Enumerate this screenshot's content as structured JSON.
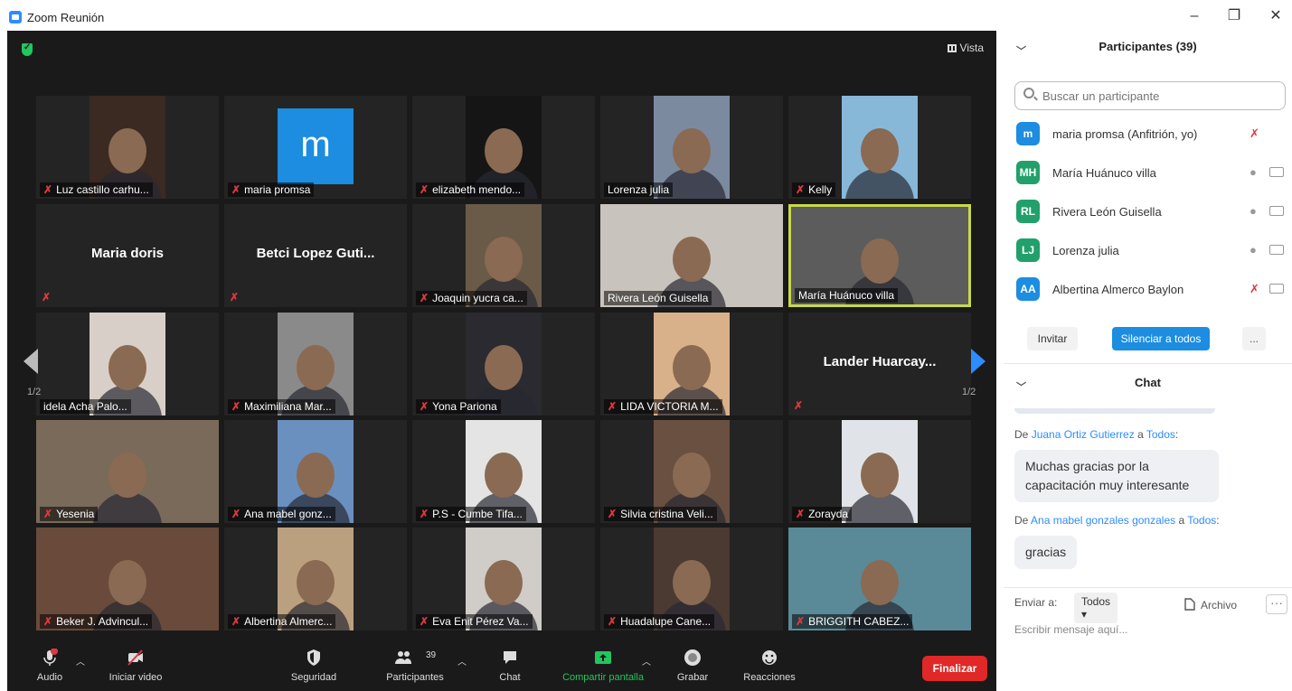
{
  "window": {
    "title": "Zoom Reunión"
  },
  "meeting": {
    "view_label": "Vista",
    "page_indicator": "1/2",
    "tiles": [
      {
        "name": "Luz castillo carhu...",
        "muted": true,
        "type": "video",
        "tone": "#3a2a22"
      },
      {
        "name": "maria promsa",
        "muted": true,
        "type": "avatar",
        "letter": "m"
      },
      {
        "name": "elizabeth mendo...",
        "muted": true,
        "type": "video",
        "tone": "#151515"
      },
      {
        "name": "Lorenza julia",
        "muted": false,
        "type": "video",
        "tone": "#7c8aa0"
      },
      {
        "name": "Kelly",
        "muted": true,
        "type": "video",
        "tone": "#88b8d8"
      },
      {
        "name": "Maria doris",
        "muted": true,
        "type": "name"
      },
      {
        "name": "Betci Lopez Guti...",
        "muted": true,
        "type": "name"
      },
      {
        "name": "Joaquin yucra ca...",
        "muted": true,
        "type": "video",
        "tone": "#6a5a48"
      },
      {
        "name": "Rivera León Guisella",
        "muted": false,
        "type": "video",
        "tone": "#c9c3bd"
      },
      {
        "name": "María Huánuco villa",
        "muted": false,
        "type": "video",
        "tone": "#5c5c5c",
        "active": true
      },
      {
        "name": "idela Acha Palo...",
        "muted": false,
        "type": "video",
        "tone": "#d8d0c8"
      },
      {
        "name": "Maximiliana Mar...",
        "muted": true,
        "type": "video",
        "tone": "#8a8a8a"
      },
      {
        "name": "Yona Pariona",
        "muted": true,
        "type": "video",
        "tone": "#2a2a30"
      },
      {
        "name": "LIDA VICTORIA M...",
        "muted": true,
        "type": "video",
        "tone": "#d8b08a"
      },
      {
        "name": "Lander Huarcay...",
        "muted": true,
        "type": "name"
      },
      {
        "name": "Yesenia",
        "muted": true,
        "type": "video",
        "tone": "#7a6a5a"
      },
      {
        "name": "Ana mabel gonz...",
        "muted": true,
        "type": "video",
        "tone": "#6a90c0"
      },
      {
        "name": "P.S - Cumbe Tifa...",
        "muted": true,
        "type": "video",
        "tone": "#e4e4e4"
      },
      {
        "name": "Silvia cristina Veli...",
        "muted": true,
        "type": "video",
        "tone": "#6a5040"
      },
      {
        "name": "Zorayda",
        "muted": true,
        "type": "video",
        "tone": "#e0e4e8"
      },
      {
        "name": "Beker J. Advincul...",
        "muted": true,
        "type": "video",
        "tone": "#6a4a3a"
      },
      {
        "name": "Albertina Almerc...",
        "muted": true,
        "type": "video",
        "tone": "#bba080"
      },
      {
        "name": "Eva Enit Pérez Va...",
        "muted": true,
        "type": "video",
        "tone": "#d0ccc8"
      },
      {
        "name": "Huadalupe Cane...",
        "muted": true,
        "type": "video",
        "tone": "#4a3a32"
      },
      {
        "name": "BRIGGITH CABEZ...",
        "muted": true,
        "type": "video",
        "tone": "#5a8a98"
      }
    ]
  },
  "toolbar": {
    "audio": "Audio",
    "video": "Iniciar video",
    "security": "Seguridad",
    "participants": "Participantes",
    "participants_count": "39",
    "chat": "Chat",
    "share": "Compartir pantalla",
    "record": "Grabar",
    "reactions": "Reacciones",
    "end": "Finalizar"
  },
  "participants_panel": {
    "title": "Participantes (39)",
    "search_placeholder": "Buscar un participante",
    "list": [
      {
        "initials": "m",
        "name": "maria promsa (Anfitrión, yo)",
        "color": "#1c8de0",
        "mic_muted": true
      },
      {
        "initials": "MH",
        "name": "María Huánuco villa",
        "color": "#22a06b",
        "mic_muted": false
      },
      {
        "initials": "RL",
        "name": "Rivera León Guisella",
        "color": "#22a06b",
        "mic_muted": false
      },
      {
        "initials": "LJ",
        "name": "Lorenza julia",
        "color": "#22a06b",
        "mic_muted": false
      },
      {
        "initials": "AA",
        "name": "Albertina Almerco Baylon",
        "color": "#1c8de0",
        "mic_muted": true
      }
    ],
    "invite_label": "Invitar",
    "mute_all_label": "Silenciar a todos",
    "more_label": "..."
  },
  "chat_panel": {
    "title": "Chat",
    "messages": [
      {
        "prefix": "De ",
        "from": "Juana Ortiz Gutierrez",
        "to_word": " a ",
        "to": "Todos",
        "colon": ":",
        "text": "Muchas gracias por la capacitación muy interesante"
      },
      {
        "prefix": "De ",
        "from": "Ana mabel gonzales gonzales",
        "to_word": " a ",
        "to": "Todos",
        "colon": ":",
        "text": "gracias"
      }
    ],
    "send_to_label": "Enviar a:",
    "send_to_value": "Todos",
    "file_label": "Archivo",
    "input_placeholder": "Escribir mensaje aquí..."
  }
}
